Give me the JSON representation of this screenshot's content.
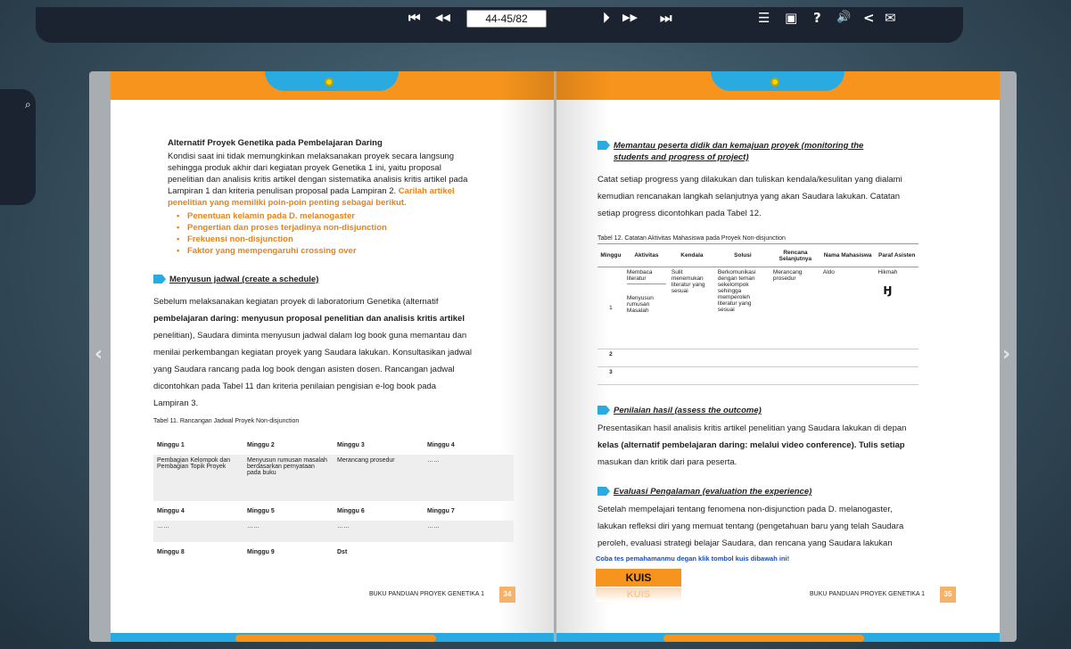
{
  "toolbar": {
    "page_indicator": "44-45/82",
    "icons": {
      "first": "⏮",
      "prev_fast": "◀◀",
      "prev": "⏴",
      "next": "⏵",
      "next_fast": "▶▶",
      "last": "⏭",
      "toc": "☰",
      "display": "▣",
      "help": "?",
      "sound": "🔊",
      "share": "<",
      "mail": "✉"
    }
  },
  "sidebar": {
    "search_icon": "⌕"
  },
  "nav": {
    "prev_arrow": "‹",
    "next_arrow": "›"
  },
  "left_page": {
    "title": "Alternatif Proyek Genetika pada Pembelajaran Daring",
    "intro_lines": [
      "Kondisi saat ini tidak memungkinkan melaksanakan proyek secara langsung",
      "sehingga produk akhir dari kegiatan proyek Genetika 1 ini, yaitu proposal",
      "penelitian dan analisis kritis artikel dengan sistematika analisis kritis artikel pada"
    ],
    "intro_last_plain": "Lampiran 1 dan kriteria penulisan proposal pada Lampiran 2. ",
    "intro_last_orange": "Carilah artikel",
    "intro_orange_line": "penelitian yang memiliki poin-poin penting sebagai berikut.",
    "bullets": [
      "Penentuan kelamin pada D. melanogaster",
      "Pengertian dan proses terjadinya non-disjunction",
      "Frekuensi non-disjunction",
      "Faktor yang mempengaruhi crossing over"
    ],
    "section_heading": "Menyusun jadwal (create a schedule)",
    "section_paragraph": [
      "Sebelum melaksanakan kegiatan proyek di laboratorium Genetika (alternatif",
      "pembelajaran daring: menyusun proposal penelitian dan analisis kritis artikel",
      "penelitian), Saudara diminta menyusun jadwal dalam log book guna memantau dan",
      "menilai perkembangan kegiatan proyek yang Saudara lakukan. Konsultasikan jadwal",
      "yang Saudara rancang pada log book dengan asisten dosen. Rancangan jadwal",
      "dicontohkan pada Tabel 11 dan kriteria penilaian pengisian e-log book pada",
      "Lampiran 3."
    ],
    "table_caption": "Tabel 11. Rancangan Jadwal Proyek Non-disjunction",
    "schedule_rows": [
      [
        "Minggu 1",
        "Minggu 2",
        "Minggu 3",
        "Minggu 4"
      ],
      [
        "Pembagian Kelompok dan Pembagian Topik Proyek",
        "Menyusun rumusan masalah berdasarkan pernyataan pada buku",
        "Merancang prosedur",
        "……"
      ],
      [
        "Minggu 4",
        "Minggu 5",
        "Minggu 6",
        "Minggu 7"
      ],
      [
        "……",
        "……",
        "……",
        "……"
      ],
      [
        "Minggu 8",
        "Minggu 9",
        "Dst",
        ""
      ]
    ],
    "footer": "BUKU PANDUAN PROYEK GENETIKA 1",
    "page_number": "34"
  },
  "right_page": {
    "heading1_line1": "Memantau peserta didik dan kemajuan proyek (monitoring the",
    "heading1_line2": "students and progress of project)",
    "para1": [
      "Catat setiap progress yang dilakukan dan tuliskan kendala/kesulitan yang dialami",
      "kemudian rencanakan langkah selanjutnya yang akan Saudara lakukan. Catatan",
      "setiap progress dicontohkan pada Tabel 12."
    ],
    "table_caption": "Tabel 12. Catatan Aktivitas Mahasiswa pada Proyek Non-disjunction",
    "table_headers": [
      "Minggu",
      "Aktivitas",
      "Kendala",
      "Solusi",
      "Rencana Selanjutnya",
      "Nama Mahasiswa",
      "Paraf Asisten"
    ],
    "row1": {
      "week": "1",
      "activity_a": "Membaca literatur",
      "activity_b": "Menyusun rumusan Masalah",
      "kendala": "Sulit menemukan literatur yang sesuai",
      "solusi": "Berkomunikasi dengan teman sekelompok sehingga memperoleh literatur yang sesuai",
      "rencana": "Merancang prosedur",
      "nama": "Aldo",
      "paraf": "Hikmah"
    },
    "row2_week": "2",
    "row3_week": "3",
    "heading2": "Penilaian hasil (assess the outcome)",
    "para2": [
      "Presentasikan hasil analisis kritis artikel penelitian yang Saudara lakukan di depan",
      "kelas (alternatif pembelajaran daring: melalui video conference). Tulis setiap",
      "masukan dan kritik dari para peserta."
    ],
    "heading3": "Evaluasi Pengalaman (evaluation the experience)",
    "para3": [
      "Setelah mempelajari tentang fenomena non-disjunction pada D. melanogaster,",
      "lakukan refleksi diri yang memuat tentang (pengetahuan baru yang telah Saudara",
      "peroleh, evaluasi strategi belajar Saudara, dan rencana yang Saudara lakukan"
    ],
    "quiz_prompt": "Coba tes pemahamanmu degan klik tombol kuis dibawah ini!",
    "quiz_button": "KUIS",
    "footer": "BUKU PANDUAN PROYEK GENETIKA 1",
    "page_number": "35"
  },
  "colors": {
    "orange": "#f7941d",
    "blue": "#29abe2",
    "toolbar": "#1b2230"
  }
}
